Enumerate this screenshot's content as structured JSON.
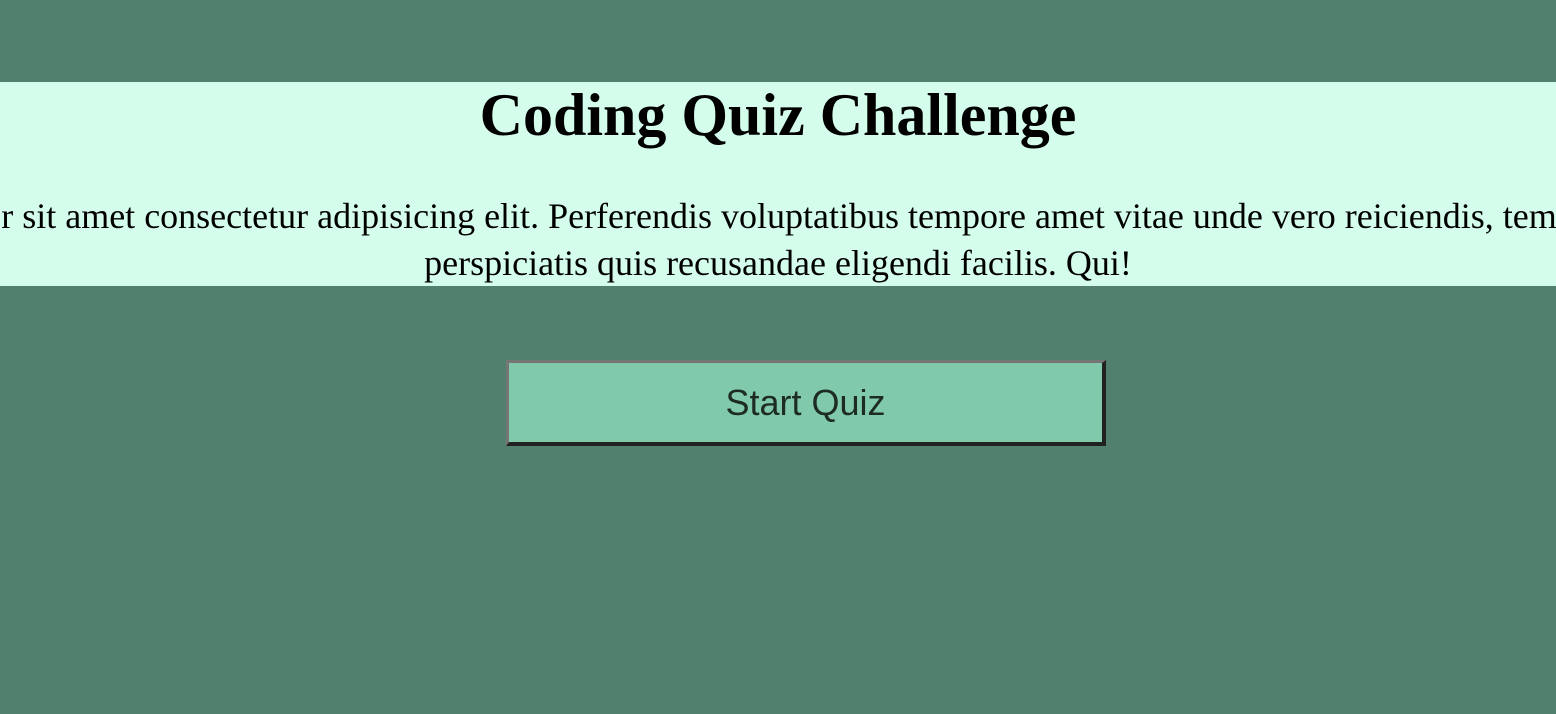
{
  "intro": {
    "title": "Coding Quiz Challenge",
    "description": "Lorem ipsum dolor sit amet consectetur adipisicing elit. Perferendis voluptatibus tempore amet vitae unde vero reiciendis, temporibus omnis iste perspiciatis quis recusandae eligendi facilis. Qui!"
  },
  "start_button": {
    "label": "Start Quiz"
  },
  "colors": {
    "page_background": "#51816e",
    "banner_background": "#d5fdec",
    "button_background": "#80c9ab",
    "button_text": "#1d2b24"
  }
}
